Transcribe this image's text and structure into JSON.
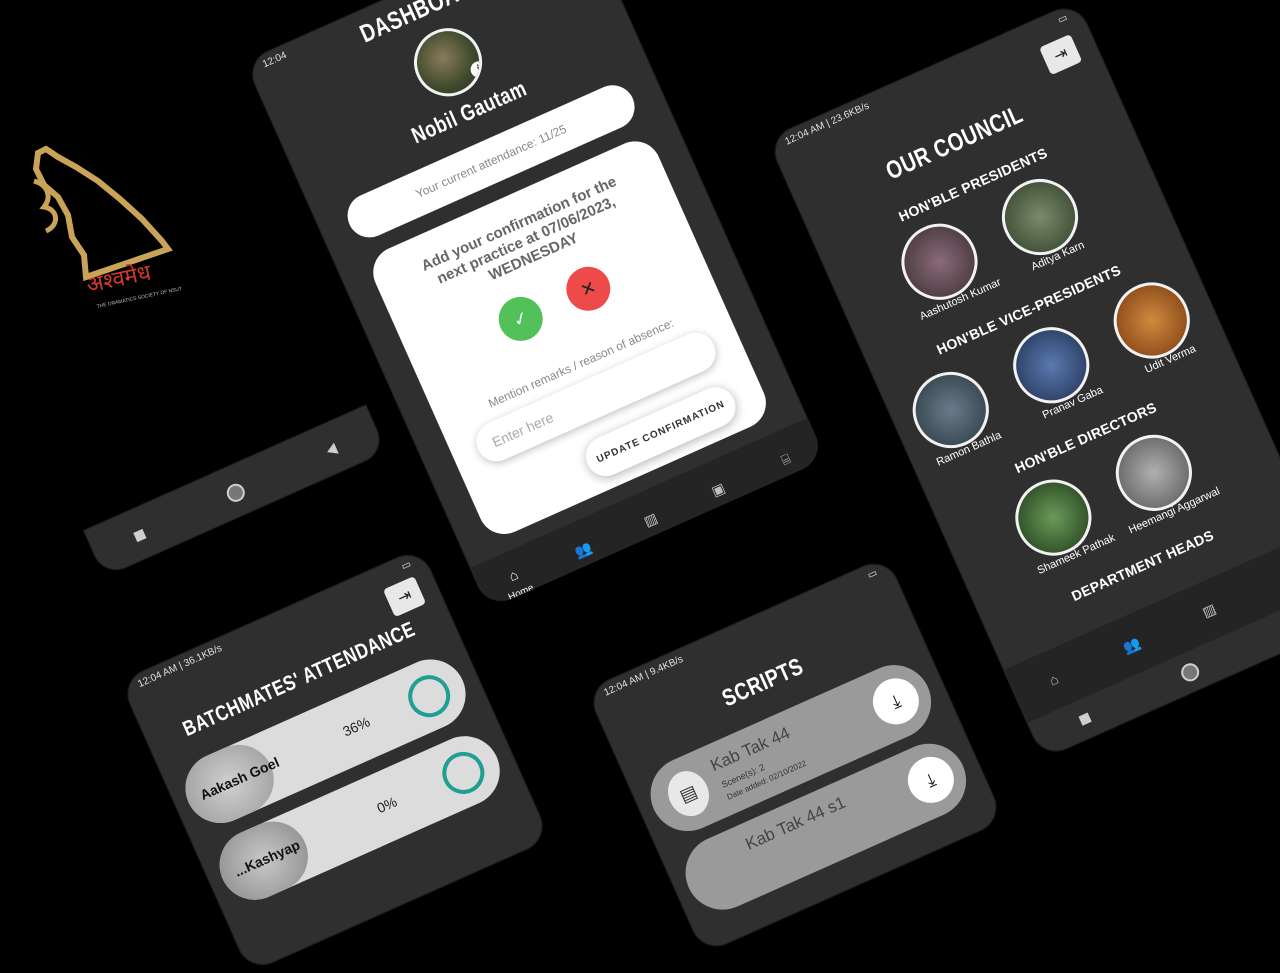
{
  "logo": {
    "script_text": "अश्वमेध",
    "tagline": "THE DRAMATICS SOCIETY OF NSUT"
  },
  "dashboard": {
    "status_time": "12:04",
    "title": "DASHBOARD",
    "user_name": "Nobil Gautam",
    "attendance_text": "Your current attendance: 11/25",
    "confirm_text": "Add your confirmation for the next practice at 07/06/2023, WEDNESDAY",
    "remarks_label": "Mention remarks / reason of absence:",
    "input_placeholder": "Enter here",
    "update_button": "UPDATE CONFIRMATION",
    "nav_home": "Home"
  },
  "council": {
    "status_left": "12:04 AM | 23.6KB/s",
    "title": "OUR COUNCIL",
    "sections": [
      {
        "heading": "HON'BLE PRESIDENTS",
        "members": [
          "Aashutosh Kumar",
          "Aditya Karn"
        ]
      },
      {
        "heading": "HON'BLE VICE-PRESIDENTS",
        "members": [
          "Ramon Bathla",
          "Pranav Gaba",
          "Udit Verma"
        ]
      },
      {
        "heading": "HON'BLE DIRECTORS",
        "members": [
          "Shameek Pathak",
          "Heemangi Aggarwal"
        ]
      },
      {
        "heading": "DEPARTMENT HEADS",
        "members": []
      }
    ]
  },
  "attendance": {
    "status_left": "12:04 AM | 36.1KB/s",
    "title": "BATCHMATES' ATTENDANCE",
    "rows": [
      {
        "name": "Aakash Goel",
        "percent": "36%"
      },
      {
        "name": "...Kashyap",
        "percent": "0%"
      }
    ]
  },
  "scripts": {
    "status_left": "12:04 AM | 9.4KB/s",
    "title": "SCRIPTS",
    "items": [
      {
        "name": "Kab Tak 44",
        "scenes": "Scene(s): 2",
        "date": "Date added: 02/10/2022"
      },
      {
        "name": "Kab Tak 44 s1",
        "scenes": "",
        "date": ""
      }
    ]
  },
  "colors": {
    "background": "#000000",
    "phone": "#2f2f2f",
    "accept": "#52c15a",
    "reject": "#ee4a4a",
    "ring": "#1f9e94"
  }
}
